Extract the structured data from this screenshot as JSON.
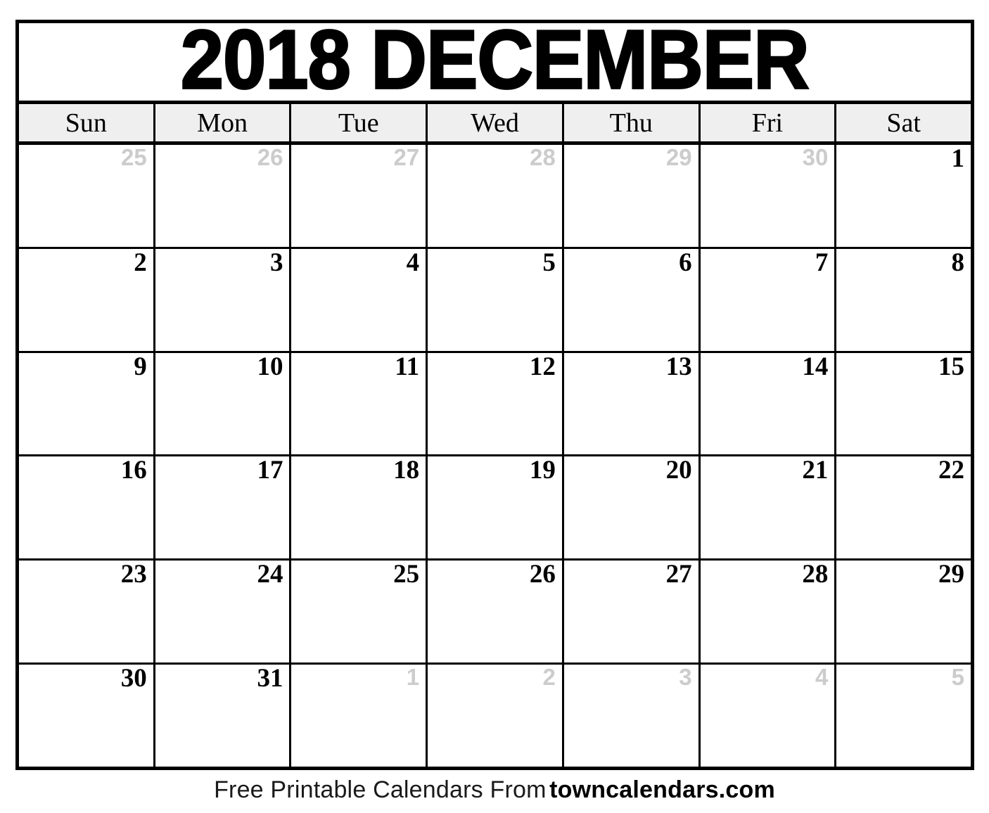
{
  "calendar": {
    "title": "2018 DECEMBER",
    "year": "2018",
    "month": "DECEMBER",
    "weekday_headers": [
      {
        "label": "Sun"
      },
      {
        "label": "Mon"
      },
      {
        "label": "Tue"
      },
      {
        "label": "Wed"
      },
      {
        "label": "Thu"
      },
      {
        "label": "Fri"
      },
      {
        "label": "Sat"
      }
    ],
    "weeks": [
      {
        "days": [
          {
            "number": "25",
            "in_month": false
          },
          {
            "number": "26",
            "in_month": false
          },
          {
            "number": "27",
            "in_month": false
          },
          {
            "number": "28",
            "in_month": false
          },
          {
            "number": "29",
            "in_month": false
          },
          {
            "number": "30",
            "in_month": false
          },
          {
            "number": "1",
            "in_month": true
          }
        ]
      },
      {
        "days": [
          {
            "number": "2",
            "in_month": true
          },
          {
            "number": "3",
            "in_month": true
          },
          {
            "number": "4",
            "in_month": true
          },
          {
            "number": "5",
            "in_month": true
          },
          {
            "number": "6",
            "in_month": true
          },
          {
            "number": "7",
            "in_month": true
          },
          {
            "number": "8",
            "in_month": true
          }
        ]
      },
      {
        "days": [
          {
            "number": "9",
            "in_month": true
          },
          {
            "number": "10",
            "in_month": true
          },
          {
            "number": "11",
            "in_month": true
          },
          {
            "number": "12",
            "in_month": true
          },
          {
            "number": "13",
            "in_month": true
          },
          {
            "number": "14",
            "in_month": true
          },
          {
            "number": "15",
            "in_month": true
          }
        ]
      },
      {
        "days": [
          {
            "number": "16",
            "in_month": true
          },
          {
            "number": "17",
            "in_month": true
          },
          {
            "number": "18",
            "in_month": true
          },
          {
            "number": "19",
            "in_month": true
          },
          {
            "number": "20",
            "in_month": true
          },
          {
            "number": "21",
            "in_month": true
          },
          {
            "number": "22",
            "in_month": true
          }
        ]
      },
      {
        "days": [
          {
            "number": "23",
            "in_month": true
          },
          {
            "number": "24",
            "in_month": true
          },
          {
            "number": "25",
            "in_month": true
          },
          {
            "number": "26",
            "in_month": true
          },
          {
            "number": "27",
            "in_month": true
          },
          {
            "number": "28",
            "in_month": true
          },
          {
            "number": "29",
            "in_month": true
          }
        ]
      },
      {
        "days": [
          {
            "number": "30",
            "in_month": true
          },
          {
            "number": "31",
            "in_month": true
          },
          {
            "number": "1",
            "in_month": false
          },
          {
            "number": "2",
            "in_month": false
          },
          {
            "number": "3",
            "in_month": false
          },
          {
            "number": "4",
            "in_month": false
          },
          {
            "number": "5",
            "in_month": false
          }
        ]
      }
    ]
  },
  "footer": {
    "text": "Free Printable Calendars From",
    "site": "towncalendars.com"
  },
  "colors": {
    "frame": "#000000",
    "header_background": "#efefef",
    "in_month_text": "#000000",
    "other_month_text": "#cccccc",
    "page_background": "#ffffff"
  }
}
